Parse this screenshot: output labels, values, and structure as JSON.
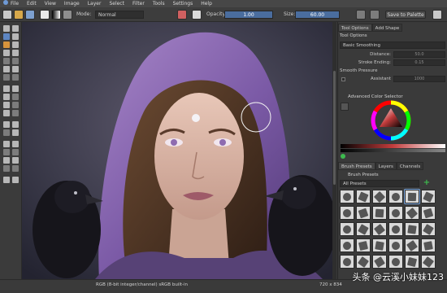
{
  "menubar": {
    "items": [
      "File",
      "Edit",
      "View",
      "Image",
      "Layer",
      "Select",
      "Filter",
      "Tools",
      "Settings",
      "Help"
    ]
  },
  "toolbar": {
    "mode_label": "Mode:",
    "mode_value": "Normal",
    "opacity_label": "Opacity:",
    "opacity_value": "1.00",
    "size_label": "Size:",
    "size_value": "60.00",
    "save_palette_label": "Save to Palette",
    "icons": [
      "new-document-icon",
      "open-icon",
      "save-icon",
      "brush-preset-icon",
      "gradient-icon",
      "pattern-icon",
      "reset-icon",
      "eraser-icon",
      "alpha-lock-icon",
      "mirror-h-icon",
      "mirror-v-icon",
      "wrap-icon"
    ]
  },
  "tool_options": {
    "tabs": [
      "Tool Options",
      "Add Shape"
    ],
    "title": "Tool Options",
    "mode": "Basic Smoothing",
    "fields": [
      {
        "label": "Distance:",
        "value": "50.0"
      },
      {
        "label": "Stroke Ending:",
        "value": "0.15"
      },
      {
        "label": "Smooth Pressure",
        "value": ""
      },
      {
        "label": "Assistant",
        "value": "1000"
      }
    ]
  },
  "color_selector": {
    "title": "Advanced Color Selector"
  },
  "brush_panel": {
    "tabs": [
      "Brush Presets",
      "Layers",
      "Channels"
    ],
    "title": "Brush Presets",
    "filter_value": "All Presets"
  },
  "statusbar": {
    "color_space": "RGB (8-bit integer/channel)  sRGB built-in",
    "dimensions": "720 x 834"
  },
  "watermark": "头条 @云溪小妹妹123",
  "colors": {
    "accent": "#4a6d9e",
    "panel": "#3a3a3a",
    "canvas_bg": "#262626"
  }
}
